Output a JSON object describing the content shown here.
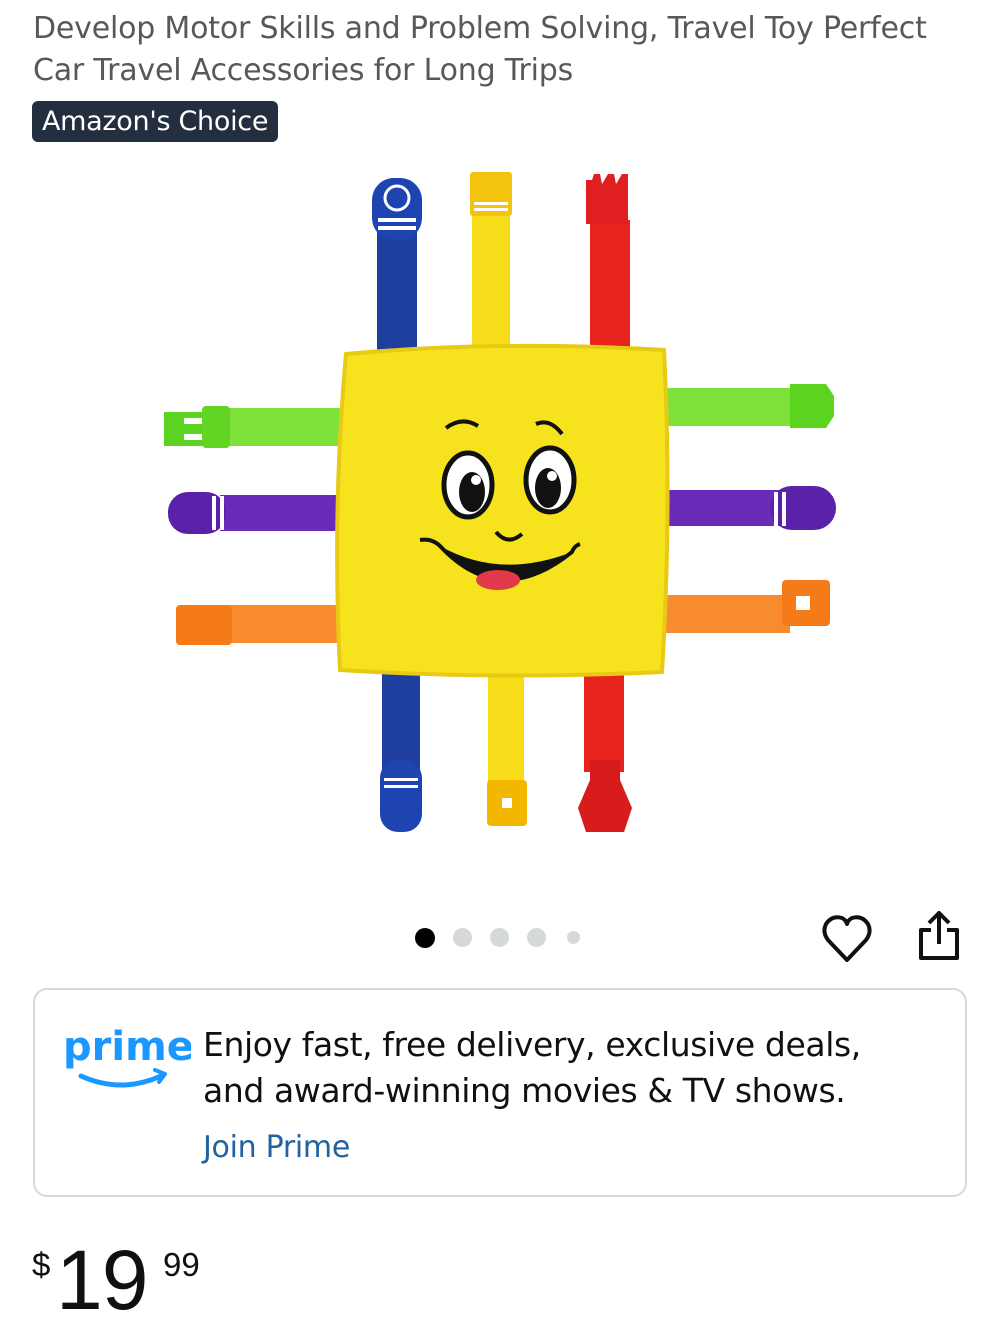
{
  "product": {
    "title_line1": "Develop Motor Skills and Problem Solving, Travel Toy Perfect",
    "title_line2": "Car Travel Accessories for Long Trips",
    "badge": "Amazon's Choice",
    "image_alt_icon": "plush-buckle-toy-image"
  },
  "carousel": {
    "count": 5,
    "active_index": 0
  },
  "actions": {
    "wishlist_icon": "heart-icon",
    "share_icon": "share-icon"
  },
  "prime": {
    "logo_text": "prime",
    "line1": "Enjoy fast, free delivery, exclusive deals,",
    "line2": "and award-winning movies & TV shows.",
    "link": "Join Prime"
  },
  "price": {
    "symbol": "$",
    "whole": "19",
    "fraction": "99"
  },
  "colors": {
    "badge_bg": "#232f3e",
    "link": "#2162a1",
    "prime_blue": "#1a98ff",
    "dot_active": "#000000",
    "dot_inactive": "#d5d9d9"
  }
}
